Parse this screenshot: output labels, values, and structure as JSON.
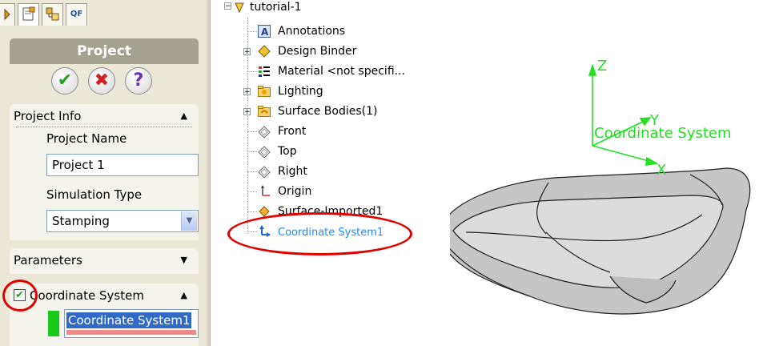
{
  "left_panel": {
    "tabs": [
      {
        "name": "feature-manager-tab",
        "label": ""
      },
      {
        "name": "property-manager-tab",
        "label": ""
      },
      {
        "name": "configuration-manager-tab",
        "label": ""
      },
      {
        "name": "qf-tab",
        "label": "QF"
      }
    ],
    "title": "Project",
    "actions": {
      "ok": "✔",
      "cancel": "✖",
      "help": "?"
    },
    "project_info": {
      "header": "Project Info",
      "project_name_label": "Project Name",
      "project_name_value": "Project 1",
      "simulation_type_label": "Simulation Type",
      "simulation_type_value": "Stamping"
    },
    "parameters": {
      "header": "Parameters"
    },
    "coordinate_system": {
      "header": "Coordinate System",
      "checked": true,
      "selection": "Coordinate System1"
    }
  },
  "tree": {
    "root": "tutorial-1",
    "items": [
      {
        "label": "Annotations",
        "expandable": false,
        "icon": "annotations-icon"
      },
      {
        "label": "Design Binder",
        "expandable": true,
        "icon": "design-binder-icon"
      },
      {
        "label": "Material <not specifi...",
        "expandable": false,
        "icon": "material-icon"
      },
      {
        "label": "Lighting",
        "expandable": true,
        "icon": "lighting-folder-icon"
      },
      {
        "label": "Surface Bodies(1)",
        "expandable": true,
        "icon": "surface-bodies-folder-icon"
      },
      {
        "label": "Front",
        "expandable": false,
        "icon": "plane-icon"
      },
      {
        "label": "Top",
        "expandable": false,
        "icon": "plane-icon"
      },
      {
        "label": "Right",
        "expandable": false,
        "icon": "plane-icon"
      },
      {
        "label": "Origin",
        "expandable": false,
        "icon": "origin-icon"
      },
      {
        "label": "Surface-Imported1",
        "expandable": false,
        "icon": "surface-imported-icon"
      },
      {
        "label": "Coordinate System1",
        "expandable": false,
        "icon": "coordinate-system-icon",
        "selected": true
      }
    ]
  },
  "viewport": {
    "axes": {
      "z": "Z",
      "y": "Y",
      "x": "X",
      "name": "Coordinate System"
    }
  },
  "colors": {
    "axis_green": "#22e022",
    "highlight_red": "#e00000",
    "selection_blue": "#1a8cff"
  }
}
